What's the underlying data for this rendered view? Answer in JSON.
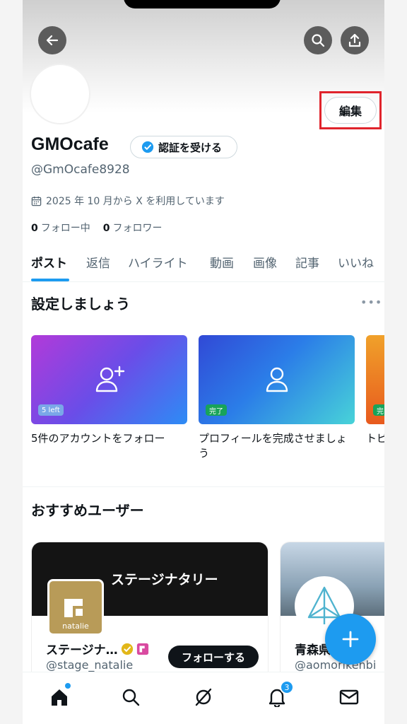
{
  "profile": {
    "name": "GMOcafe",
    "handle": "@GmOcafe8928",
    "verify_label": "認証を受ける",
    "edit_label": "編集",
    "joined": "2025 年 10 月から X を利用しています",
    "following_count": "0",
    "following_label": "フォロー中",
    "followers_count": "0",
    "followers_label": "フォロワー"
  },
  "tabs": [
    "ポスト",
    "返信",
    "ハイライト",
    "動画",
    "画像",
    "記事",
    "いいね"
  ],
  "setup": {
    "title": "設定しましょう",
    "cards": [
      {
        "pill": "5 left",
        "caption": "5件のアカウントをフォロー"
      },
      {
        "pill": "完了",
        "caption": "プロフィールを完成させましょう"
      },
      {
        "pill": "完",
        "caption": "トピ"
      }
    ]
  },
  "suggested": {
    "title": "おすすめユーザー",
    "users": [
      {
        "banner_text": "ステージナタリー",
        "logo_text": "natalie",
        "name": "ステージナ…",
        "handle": "@stage_natalie",
        "follow_label": "フォローする"
      },
      {
        "name": "青森県…館",
        "handle": "@aomorikenbi"
      }
    ]
  },
  "nav": {
    "notifications_badge": "3"
  },
  "colors": {
    "accent": "#1d9bf0",
    "highlight": "#e0242c"
  }
}
